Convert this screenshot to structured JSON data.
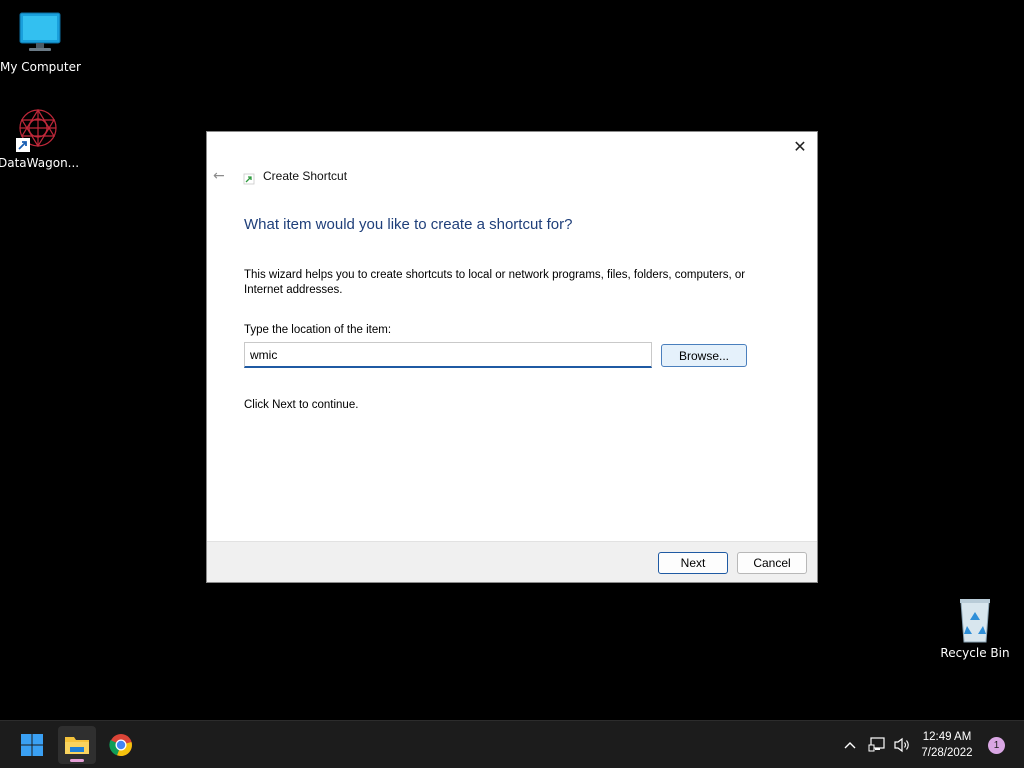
{
  "desktop": {
    "icons": [
      {
        "label": "My Computer",
        "icon": "monitor-icon"
      },
      {
        "label": "DataWagon...",
        "icon": "datawagon-app-icon"
      },
      {
        "label": "Recycle Bin",
        "icon": "recycle-bin-icon"
      }
    ]
  },
  "dialog": {
    "title": "Create Shortcut",
    "close_glyph": "✕",
    "back_glyph": "←",
    "heading": "What item would you like to create a shortcut for?",
    "description": "This wizard helps you to create shortcuts to local or network programs, files, folders, computers, or Internet addresses.",
    "location_label": "Type the location of the item:",
    "location_value": "wmic ",
    "browse_label": "Browse...",
    "continue_text": "Click Next to continue.",
    "next_label": "Next",
    "cancel_label": "Cancel"
  },
  "taskbar": {
    "pinned": [
      "start-icon",
      "file-explorer-icon",
      "chrome-icon"
    ],
    "clock_time": "12:49 AM",
    "clock_date": "7/28/2022",
    "notification_count": "1"
  },
  "colors": {
    "heading": "#1f3f7a",
    "accent": "#1f5aa3",
    "taskbar": "#1c1c1c"
  }
}
